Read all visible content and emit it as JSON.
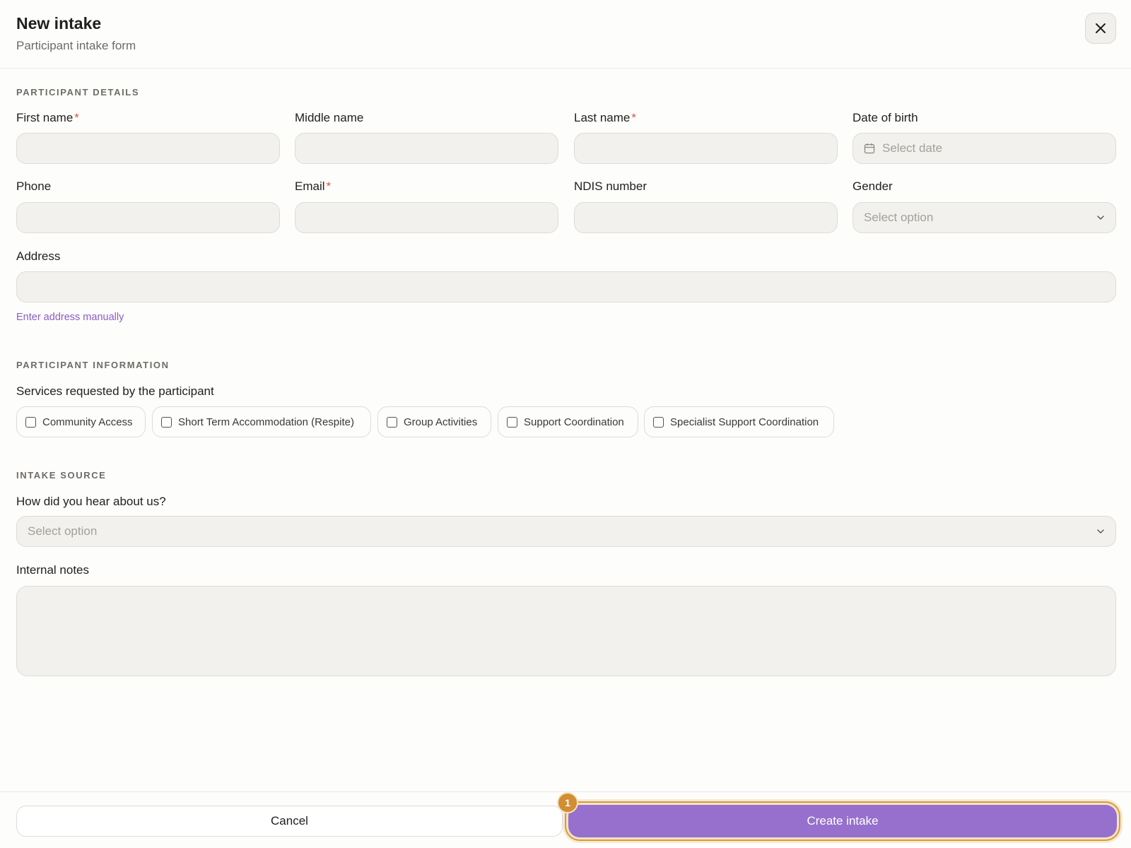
{
  "header": {
    "title": "New intake",
    "subtitle": "Participant intake form"
  },
  "sections": {
    "participant_details": "PARTICIPANT DETAILS",
    "participant_information": "PARTICIPANT INFORMATION",
    "intake_source": "INTAKE SOURCE"
  },
  "fields": {
    "first_name": {
      "label": "First name",
      "required": "*",
      "value": ""
    },
    "middle_name": {
      "label": "Middle name",
      "value": ""
    },
    "last_name": {
      "label": "Last name",
      "required": "*",
      "value": ""
    },
    "date_of_birth": {
      "label": "Date of birth",
      "placeholder": "Select date"
    },
    "phone": {
      "label": "Phone",
      "value": ""
    },
    "email": {
      "label": "Email",
      "required": "*",
      "value": ""
    },
    "ndis_number": {
      "label": "NDIS number",
      "value": ""
    },
    "gender": {
      "label": "Gender",
      "placeholder": "Select option"
    },
    "address": {
      "label": "Address",
      "value": "",
      "manual_link": "Enter address manually"
    },
    "services": {
      "label": "Services requested by the participant",
      "options": [
        "Community Access",
        "Short Term Accommodation (Respite)",
        "Group Activities",
        "Support Coordination",
        "Specialist Support Coordination"
      ]
    },
    "hear_about": {
      "label": "How did you hear about us?",
      "placeholder": "Select option"
    },
    "internal_notes": {
      "label": "Internal notes",
      "value": ""
    }
  },
  "footer": {
    "cancel_label": "Cancel",
    "create_label": "Create intake",
    "badge": "1"
  },
  "colors": {
    "accent": "#9670cc",
    "link": "#8b5cc7",
    "required": "#d9534f",
    "badge": "#d18e34"
  },
  "icons": {
    "close": "close-icon",
    "calendar": "calendar-icon",
    "chevron": "chevron-down-icon"
  }
}
